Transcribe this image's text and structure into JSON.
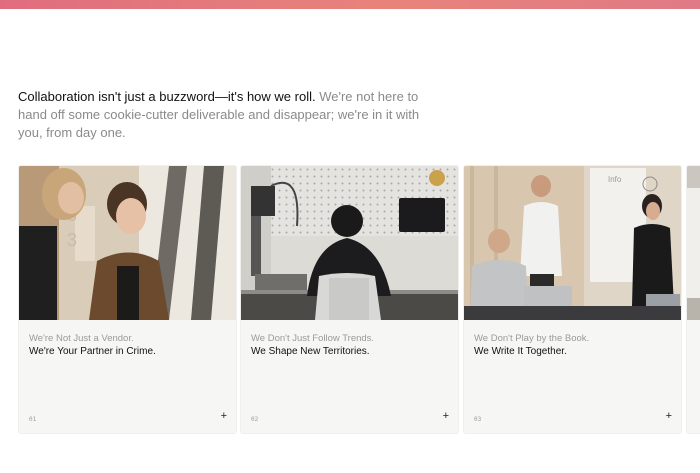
{
  "intro": {
    "lead": "Collaboration isn't just a buzzword—it's how we roll.",
    "rest": " We're not here to hand off some cookie-cutter deliverable and disappear; we're in it with you, from day one."
  },
  "cards": [
    {
      "subtitle": "We're Not Just a Vendor.",
      "title": "We're Your Partner in Crime.",
      "number": "01",
      "action": "+",
      "photo": "two-women-smiling-window"
    },
    {
      "subtitle": "We Don't Just Follow Trends.",
      "title": "We Shape New Territories.",
      "number": "02",
      "action": "+",
      "photo": "man-at-workbench-pegboard"
    },
    {
      "subtitle": "We Don't Play by the Book.",
      "title": "We Write It Together.",
      "number": "03",
      "action": "+",
      "photo": "team-meeting-whiteboard"
    },
    {
      "subtitle": "",
      "title": "",
      "number": "",
      "action": "",
      "photo": "partial-card"
    }
  ]
}
